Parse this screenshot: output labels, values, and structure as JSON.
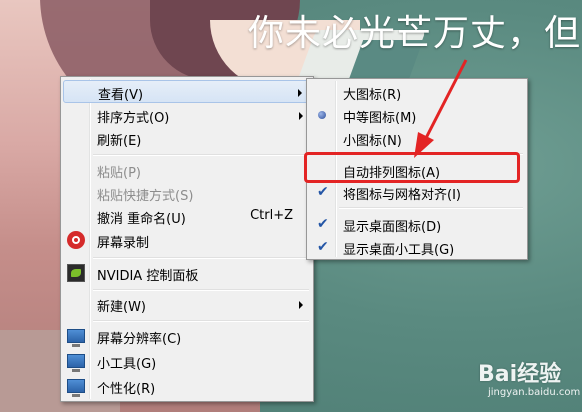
{
  "headline": "你未必光芒万丈，但",
  "main_menu": {
    "items": [
      {
        "label": "查看(V)",
        "has_submenu": true,
        "hovered": true
      },
      {
        "label": "排序方式(O)",
        "has_submenu": true
      },
      {
        "label": "刷新(E)"
      },
      {
        "label": "粘贴(P)",
        "disabled": true
      },
      {
        "label": "粘贴快捷方式(S)",
        "disabled": true
      },
      {
        "label": "撤消 重命名(U)",
        "shortcut": "Ctrl+Z"
      },
      {
        "label": "屏幕录制",
        "icon": "record-icon"
      },
      {
        "label": "NVIDIA 控制面板",
        "icon": "nvidia-icon"
      },
      {
        "label": "新建(W)",
        "has_submenu": true
      },
      {
        "label": "屏幕分辨率(C)",
        "icon": "monitor-icon"
      },
      {
        "label": "小工具(G)",
        "icon": "gadgets-icon"
      },
      {
        "label": "个性化(R)",
        "icon": "personalize-icon"
      }
    ]
  },
  "view_submenu": {
    "items": [
      {
        "label": "大图标(R)"
      },
      {
        "label": "中等图标(M)",
        "radio": true
      },
      {
        "label": "小图标(N)"
      },
      {
        "label": "自动排列图标(A)",
        "highlighted": true
      },
      {
        "label": "将图标与网格对齐(I)",
        "checked": true
      },
      {
        "label": "显示桌面图标(D)",
        "checked": true
      },
      {
        "label": "显示桌面小工具(G)",
        "checked": true
      }
    ]
  },
  "annotation": {
    "color": "#e32424"
  },
  "watermark": {
    "brand": "Bai经验",
    "site": "jingyan.baidu.com"
  }
}
